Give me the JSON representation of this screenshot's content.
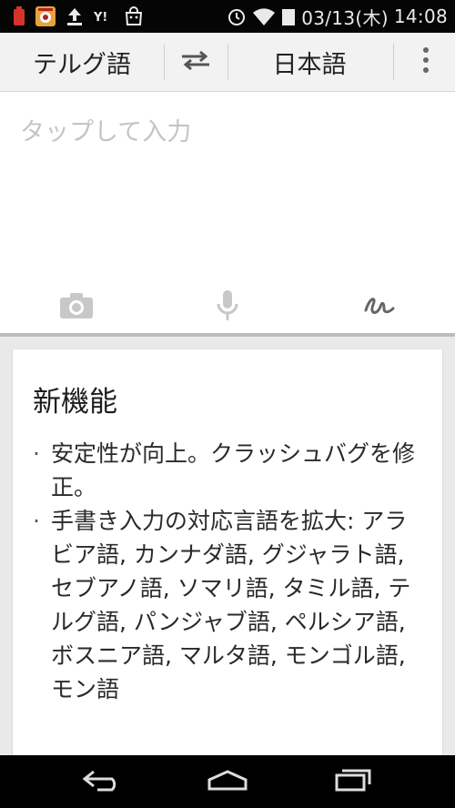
{
  "status_bar": {
    "date": "03/13(木)",
    "time": "14:08",
    "icons": [
      "battery-low-icon",
      "app-notification-icon",
      "upload-icon",
      "yahoo-icon",
      "shopping-bag-icon",
      "alarm-icon",
      "wifi-icon",
      "signal-icon"
    ]
  },
  "language_bar": {
    "source_language": "テルグ語",
    "target_language": "日本語",
    "icons": [
      "swap-icon",
      "overflow-menu-icon"
    ]
  },
  "input": {
    "placeholder": "タップして入力",
    "tools": [
      "camera-icon",
      "microphone-icon",
      "handwriting-icon"
    ]
  },
  "whats_new": {
    "title": "新機能",
    "items": [
      "安定性が向上。クラッシュバグを修正。",
      "手書き入力の対応言語を拡大: アラビア語, カンナダ語, グジャラト語, セブアノ語, ソマリ語, タミル語, テルグ語, パンジャブ語, ペルシア語, ボスニア語, マルタ語, モンゴル語, モン語"
    ]
  },
  "nav_bar": {
    "icons": [
      "back-icon",
      "home-icon",
      "recent-apps-icon"
    ]
  },
  "colors": {
    "status_bar_bg": "#050505",
    "toolbar_bg": "#f2f2f2",
    "page_bg": "#e9e9e9",
    "battery_red": "#d6342b",
    "notification_orange": "#e8a23a"
  }
}
